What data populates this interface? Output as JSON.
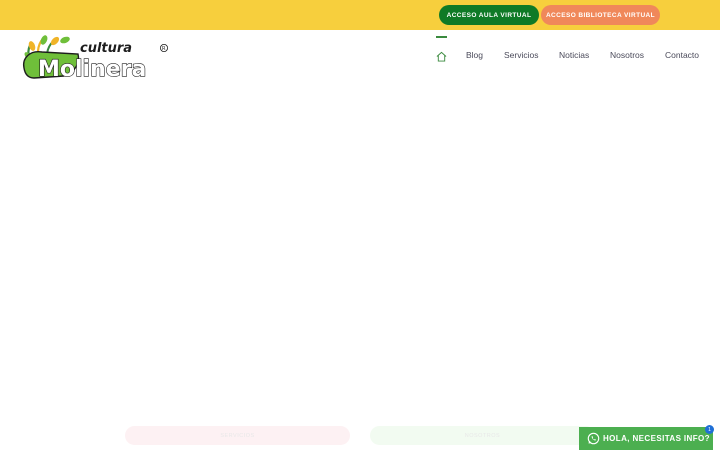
{
  "topbar": {
    "aula_label": "ACCESO AULA VIRTUAL",
    "biblioteca_label": "ACCESO BIBLIOTECA VIRTUAL",
    "background": "#f7cf3d",
    "aula_color": "#0f7a26",
    "biblioteca_color": "#f0885a"
  },
  "logo": {
    "line1": "cultura",
    "line2": "Molinera",
    "mark": "®"
  },
  "nav": {
    "home_icon": "home-icon",
    "items": [
      {
        "label": "Blog"
      },
      {
        "label": "Servicios"
      },
      {
        "label": "Noticias"
      },
      {
        "label": "Nosotros"
      },
      {
        "label": "Contacto"
      }
    ]
  },
  "footer_pills": {
    "left_label": "SERVICIOS",
    "right_label": "NOSOTROS"
  },
  "whatsapp": {
    "label": "HOLA, NECESITAS INFO?",
    "badge": "1",
    "icon": "whatsapp-icon",
    "color": "#4caf50"
  }
}
